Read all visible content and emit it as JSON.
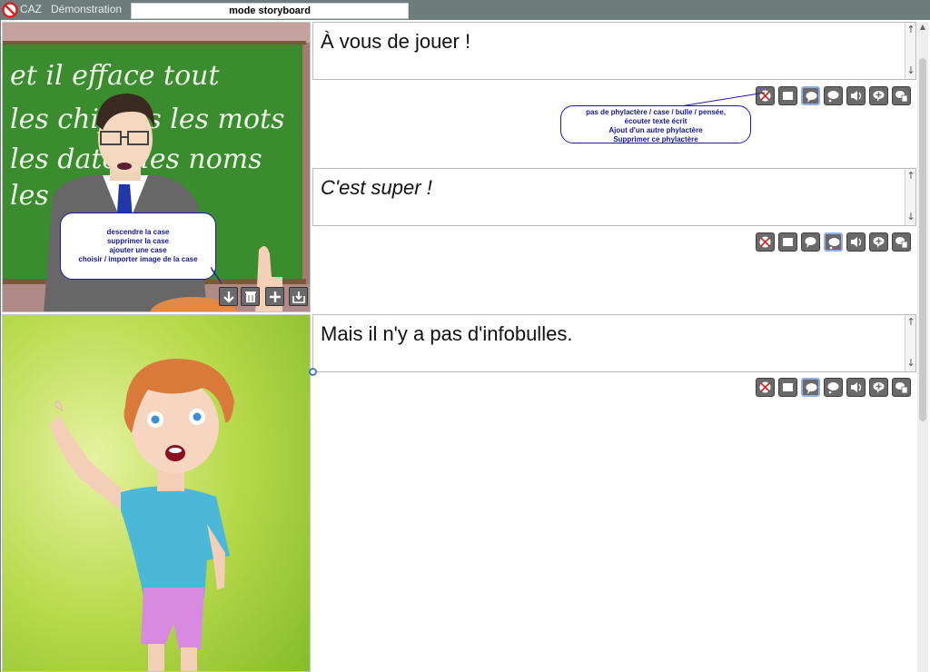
{
  "topbar": {
    "app_name": "CAZ",
    "demo_label": "Démonstration",
    "mode_label": "mode storyboard"
  },
  "panels": [
    {
      "image_alt": "Professeur devant un tableau vert",
      "blackboard_text": [
        "et il efface tout",
        "les chiffres les mots",
        "les dates les noms",
        "les pièges"
      ],
      "frames": [
        {
          "text": "À vous de jouer !",
          "italic": false
        },
        {
          "text": "C'est super !",
          "italic": true
        }
      ],
      "image_buttons": [
        "arrow-down-icon",
        "trash-icon",
        "plus-icon",
        "import-icon"
      ],
      "image_tooltip": [
        "descendre la case",
        "supprimer la case",
        "ajouter une case",
        "choisir / importer image de la case"
      ]
    },
    {
      "image_alt": "Garçon roux qui lève le doigt",
      "frames": [
        {
          "text": "Mais il n'y a pas d'infobulles.",
          "italic": false
        }
      ]
    }
  ],
  "toolbar_icons": [
    "no-bubble-icon",
    "box-icon",
    "speech-bubble-icon",
    "thought-bubble-icon",
    "speaker-icon",
    "add-bubble-icon",
    "delete-bubble-icon"
  ],
  "toolbar_tooltip": [
    "pas de phylactère / case / bulle / pensée,",
    "écouter texte écrit",
    "Ajout d'un autre phylactère",
    "Supprimer ce phylactère"
  ],
  "colors": {
    "accent": "#1a1aa8",
    "topbar": "#6f7c7c",
    "blackboard": "#3a8c2f",
    "selected": "#8fb0e6"
  }
}
